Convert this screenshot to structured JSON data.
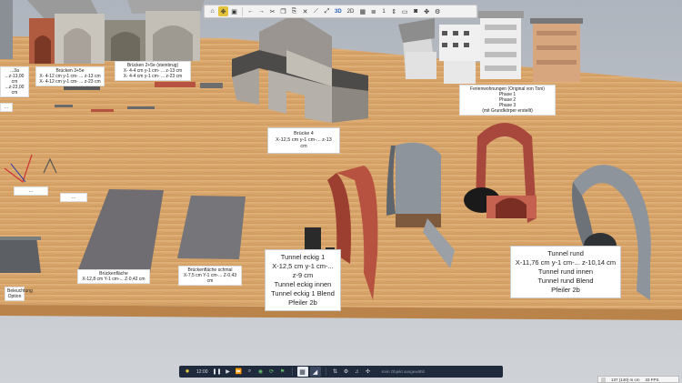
{
  "toolbar": {
    "home_icon": "home-icon",
    "active_icon": "move-tool-icon",
    "view_3d": "3D",
    "view_2d": "2D",
    "layer_number": "1"
  },
  "labels": {
    "bruecke_left": "...3a\n...z-13,00 cm\n...z-23,00 cm",
    "bruecke_3x5e": "Brücken 3+5e\nX- 4-12 cm y-1 cm- ... z-13 cm\nX- 4-12 cm y-1 cm- ... z-23 cm",
    "bruecke_steinb": "Brücken 2+5e (steinbrug)\nX- 4-4 cm y-1 cm- ... z-13 cm\nX- 4-4 cm y-1 cm- ... z-23 cm",
    "bruecke4": "Brücke 4\nX-12,5 cm y-1 cm-... z-13 cm",
    "ferienwohnungen": "Ferienwohnungen (Original von Toni)\nPhase 1\nPhase 2\nPhase 3\n(mit Grundkörper erstellt)",
    "tunnel_eckig": "Tunnel eckig 1\nX-12,5 cm y-1 cm-... z-9 cm\nTunnel eckig innen\nTunnel eckig 1 Blend\nPfeiler 2b",
    "tunnel_rund": "Tunnel rund\nX-11,76 cm y-1 cm-... z-10,14 cm\nTunnel rund innen\nTunnel rund Blend\nPfeiler 2b",
    "brueckenflaeche": "Brückenfläche\nX-12,8 cm Y-1 cm-... Z-0,42 cm",
    "brueckenflaeche_schmal": "Brückenfläche schmal\nX-7,5 cm Y-1 cm-... Z-0,43 cm",
    "beleuchtung": "Beleuchtung\nOption",
    "small_a": "...",
    "small_b": "...",
    "small_c": "..."
  },
  "bottombar": {
    "time": "12:00",
    "status": "Kein Objekt ausgewählt"
  },
  "statusbox": {
    "coords": "137 (140) m cm",
    "fps": "33 FPS"
  },
  "colors": {
    "floor": "#d8a468",
    "toolbar_active": "#e3c23a",
    "bottombar_bg": "#1f2a3c",
    "tunnel_red": "#a8483c",
    "tunnel_gray": "#8e949b"
  }
}
